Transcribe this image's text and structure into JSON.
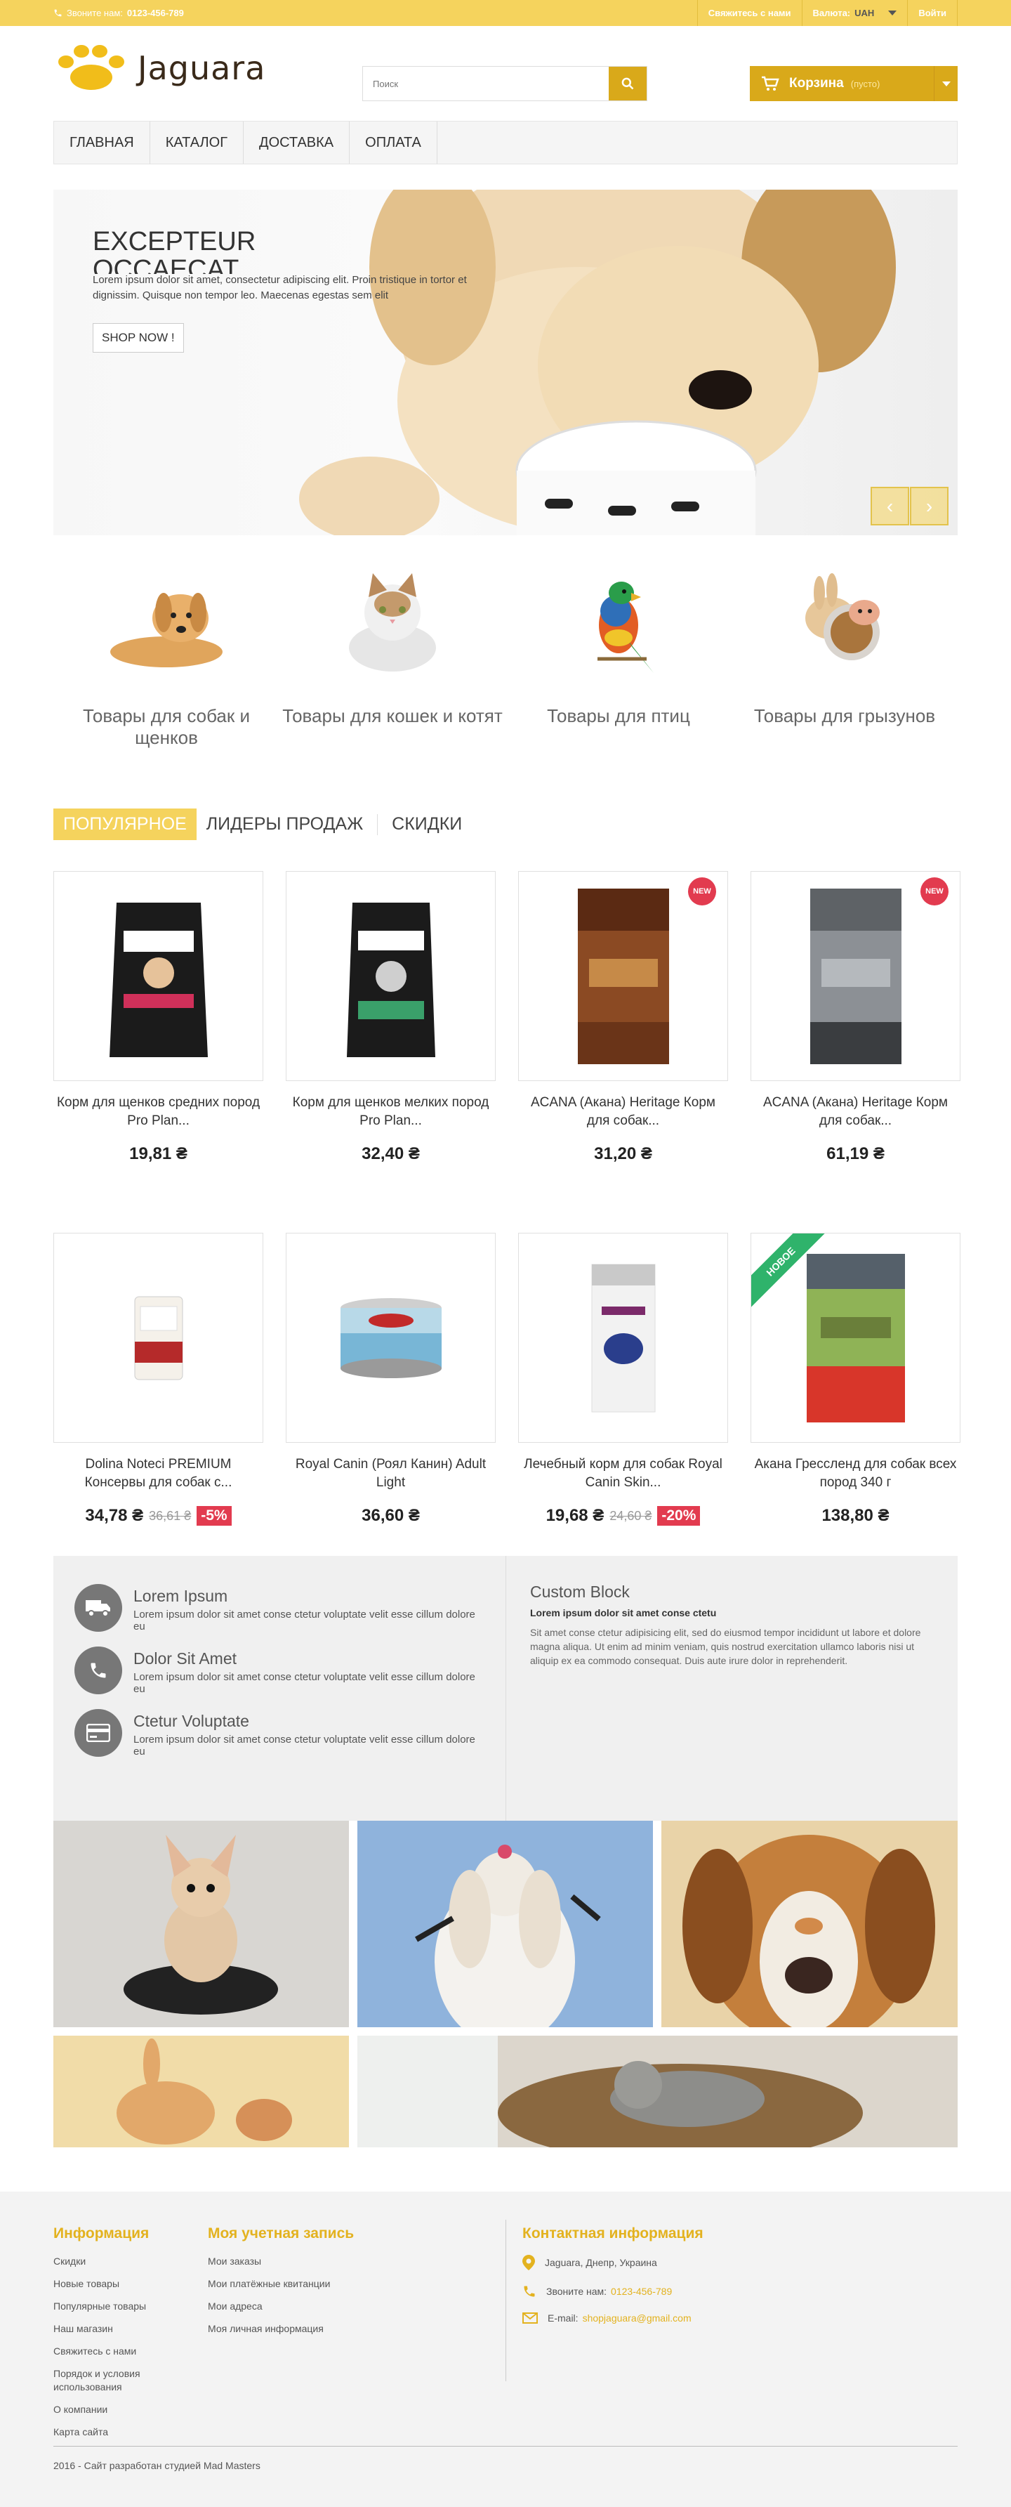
{
  "topbar": {
    "phone_label": "Звоните нам:",
    "phone": "0123-456-789",
    "contact": "Свяжитесь с нами",
    "currency_label": "Валюта:",
    "currency": "UAH",
    "login": "Войти"
  },
  "logo": {
    "text": "Jaguara"
  },
  "search": {
    "placeholder": "Поиск"
  },
  "cart": {
    "label": "Корзина",
    "status": "(пусто)"
  },
  "nav": [
    "ГЛАВНАЯ",
    "КАТАЛОГ",
    "ДОСТАВКА",
    "ОПЛАТА"
  ],
  "banner": {
    "title": "EXCEPTEUR OCCAECAT",
    "text": "Lorem ipsum dolor sit amet, consectetur adipiscing elit. Proin tristique in tortor et dignissim. Quisque non tempor leo. Maecenas egestas sem elit",
    "button": "SHOP NOW !"
  },
  "categories": [
    {
      "name": "Товары для собак и щенков",
      "icon": "dog"
    },
    {
      "name": "Товары для кошек и котят",
      "icon": "cat"
    },
    {
      "name": "Товары для птиц",
      "icon": "parrot"
    },
    {
      "name": "Товары для грызунов",
      "icon": "rodent"
    }
  ],
  "tabs": [
    "ПОПУЛЯРНОЕ",
    "ЛИДЕРЫ ПРОДАЖ",
    "СКИДКИ"
  ],
  "products_row1": [
    {
      "name": "Корм для щенков средних пород Pro Plan...",
      "price": "19,81 ₴"
    },
    {
      "name": "Корм для щенков мелких пород Pro Plan...",
      "price": "32,40 ₴"
    },
    {
      "name": "ACANA (Акана) Heritage Корм для собак...",
      "price": "31,20 ₴",
      "badge": "NEW"
    },
    {
      "name": "ACANA (Акана) Heritage Корм для собак...",
      "price": "61,19 ₴",
      "badge": "NEW"
    }
  ],
  "products_row2": [
    {
      "name": "Dolina Noteci PREMIUM Консервы для собак с...",
      "price": "34,78 ₴",
      "old": "36,61 ₴",
      "disc": "-5%"
    },
    {
      "name": "Royal Canin (Роял Канин) Adult Light",
      "price": "36,60 ₴"
    },
    {
      "name": "Лечебный корм для собак Royal Canin Skin...",
      "price": "19,68 ₴",
      "old": "24,60 ₴",
      "disc": "-20%"
    },
    {
      "name": "Акана Грессленд для собак всех пород 340 г",
      "price": "138,80 ₴",
      "ribbon": "НОВОЕ"
    }
  ],
  "features": [
    {
      "title": "Lorem Ipsum",
      "text": "Lorem ipsum dolor sit amet conse ctetur voluptate velit esse cillum dolore eu",
      "icon": "truck-icon"
    },
    {
      "title": "Dolor Sit Amet",
      "text": "Lorem ipsum dolor sit amet conse ctetur voluptate velit esse cillum dolore eu",
      "icon": "phone-icon"
    },
    {
      "title": "Ctetur Voluptate",
      "text": "Lorem ipsum dolor sit amet conse ctetur voluptate velit esse cillum dolore eu",
      "icon": "card-icon"
    }
  ],
  "custom_block": {
    "title": "Custom Block",
    "subtitle": "Lorem ipsum dolor sit amet conse ctetu",
    "text": "Sit amet conse ctetur adipisicing elit, sed do eiusmod tempor incididunt ut labore et dolore magna aliqua. Ut enim ad minim veniam, quis nostrud exercitation ullamco laboris nisi ut aliquip ex ea commodo consequat. Duis aute irure dolor in reprehenderit."
  },
  "footer": {
    "info_title": "Информация",
    "info_links": [
      "Скидки",
      "Новые товары",
      "Популярные товары",
      "Наш магазин",
      "Свяжитесь с нами",
      "Порядок и условия использования",
      "О компании",
      "Карта сайта"
    ],
    "account_title": "Моя учетная запись",
    "account_links": [
      "Мои заказы",
      "Мои платёжные квитанции",
      "Мои адреса",
      "Моя личная информация"
    ],
    "contact_title": "Контактная информация",
    "address": "Jaguara, Днепр, Украина",
    "phone_label": "Звоните нам:",
    "phone": "0123-456-789",
    "email_label": "E-mail:",
    "email": "shopjaguara@gmail.com",
    "copyright": "2016 - Сайт разработан студией Mad Masters"
  },
  "colors": {
    "accent": "#f5d35d",
    "accent_dark": "#d9a91a",
    "sale": "#e23b4f",
    "new_ribbon": "#2fb36b"
  }
}
